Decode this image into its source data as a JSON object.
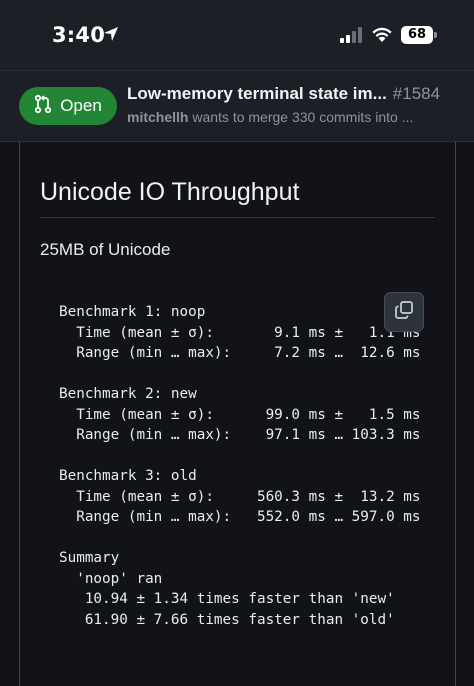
{
  "status_bar": {
    "time": "3:40",
    "battery": "68",
    "icons": [
      "location-arrow-icon",
      "cellular-signal-icon",
      "wifi-icon",
      "battery-icon"
    ]
  },
  "pr": {
    "state_label": "Open",
    "title": "Low-memory terminal state im...",
    "number": "#1584",
    "author": "mitchellh",
    "subtitle_rest": " wants to merge 330 commits into ...",
    "colors": {
      "open": "#238636",
      "frame_border": "#1f4f8c"
    }
  },
  "body": {
    "heading": "Unicode IO Throughput",
    "paragraph": "25MB of Unicode",
    "code_lines": [
      "Benchmark 1: noop",
      "  Time (mean ± σ):       9.1 ms ±   1.1 ms",
      "  Range (min … max):     7.2 ms …  12.6 ms",
      "",
      "Benchmark 2: new",
      "  Time (mean ± σ):      99.0 ms ±   1.5 ms",
      "  Range (min … max):    97.1 ms … 103.3 ms",
      "",
      "Benchmark 3: old",
      "  Time (mean ± σ):     560.3 ms ±  13.2 ms",
      "  Range (min … max):   552.0 ms … 597.0 ms",
      "",
      "Summary",
      "  'noop' ran",
      "   10.94 ± 1.34 times faster than 'new'",
      "   61.90 ± 7.66 times faster than 'old'"
    ]
  }
}
